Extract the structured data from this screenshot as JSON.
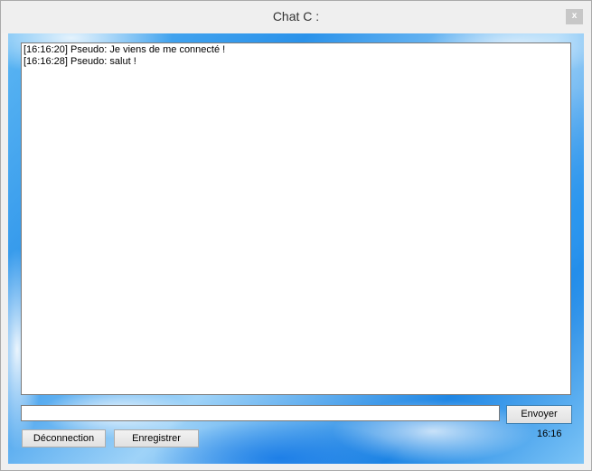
{
  "window": {
    "title": "Chat C :",
    "close_label": "x"
  },
  "chat": {
    "messages": [
      "[16:16:20] Pseudo: Je viens de me connecté !",
      "[16:16:28] Pseudo: salut !"
    ]
  },
  "composer": {
    "input_value": "",
    "send_label": "Envoyer"
  },
  "footer": {
    "disconnect_label": "Déconnection",
    "save_label": "Enregistrer",
    "time": "16:16"
  },
  "colors": {
    "background_primary": "#2a92ea",
    "background_light": "#9fd3f8",
    "send_button_border": "#3c7fb1"
  }
}
